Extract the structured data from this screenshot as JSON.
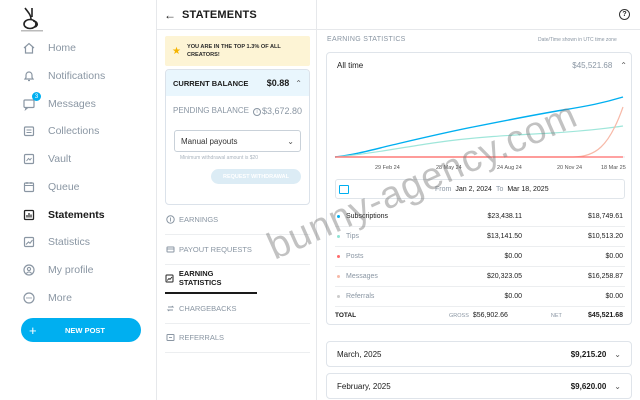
{
  "sidebar": {
    "items": [
      {
        "label": "Home",
        "icon": "home-icon"
      },
      {
        "label": "Notifications",
        "icon": "bell-icon"
      },
      {
        "label": "Messages",
        "icon": "message-icon",
        "badge": "3"
      },
      {
        "label": "Collections",
        "icon": "collections-icon"
      },
      {
        "label": "Vault",
        "icon": "vault-icon"
      },
      {
        "label": "Queue",
        "icon": "calendar-icon"
      },
      {
        "label": "Statements",
        "icon": "statements-icon",
        "active": true
      },
      {
        "label": "Statistics",
        "icon": "statistics-icon"
      },
      {
        "label": "My profile",
        "icon": "profile-icon"
      },
      {
        "label": "More",
        "icon": "more-icon"
      }
    ],
    "new_post": "NEW POST"
  },
  "header": {
    "title": "STATEMENTS"
  },
  "rank_banner": {
    "text": "YOU ARE IN THE TOP 1.3% OF ALL CREATORS!"
  },
  "balance": {
    "current_label": "CURRENT BALANCE",
    "current_value": "$0.88",
    "pending_label": "PENDING BALANCE",
    "pending_value": "$3,672.80",
    "payout_option": "Manual payouts",
    "min_note": "Minimum withdrawal amount is $20",
    "request_button": "REQUEST WITHDRAWAL"
  },
  "menu": [
    {
      "label": "EARNINGS"
    },
    {
      "label": "PAYOUT REQUESTS"
    },
    {
      "label": "EARNING STATISTICS",
      "active": true
    },
    {
      "label": "CHARGEBACKS"
    },
    {
      "label": "REFERRALS"
    }
  ],
  "stats": {
    "section_title": "EARNING STATISTICS",
    "tz_note": "Date/Time shown in UTC time zone",
    "period_label": "All time",
    "period_value": "$45,521.68",
    "date_from_label": "From",
    "date_from": "Jan 2, 2024",
    "date_to_label": "To",
    "date_to": "Mar 18, 2025",
    "chart_ticks": [
      "29 Feb 24",
      "28 May 24",
      "24 Aug 24",
      "20 Nov 24",
      "18 Mar 25"
    ],
    "rows": [
      {
        "name": "Subscriptions",
        "gross": "$23,438.11",
        "net": "$18,749.61",
        "color": "#00aff0",
        "style": "strong"
      },
      {
        "name": "Tips",
        "gross": "$13,141.50",
        "net": "$10,513.20",
        "color": "#8fe3d4",
        "style": "faded"
      },
      {
        "name": "Posts",
        "gross": "$0.00",
        "net": "$0.00",
        "color": "#ff6b6b",
        "style": "faded"
      },
      {
        "name": "Messages",
        "gross": "$20,323.05",
        "net": "$16,258.87",
        "color": "#f7b9a8",
        "style": "faded"
      },
      {
        "name": "Referrals",
        "gross": "$0.00",
        "net": "$0.00",
        "color": "#cccccc",
        "style": "faded"
      }
    ],
    "total": {
      "label": "TOTAL",
      "gross_label": "GROSS",
      "gross": "$56,902.66",
      "net_label": "NET",
      "net": "$45,521.68"
    }
  },
  "months": [
    {
      "label": "March, 2025",
      "value": "$9,215.20"
    },
    {
      "label": "February, 2025",
      "value": "$9,620.00"
    }
  ],
  "watermark": "bunny-agency.com"
}
